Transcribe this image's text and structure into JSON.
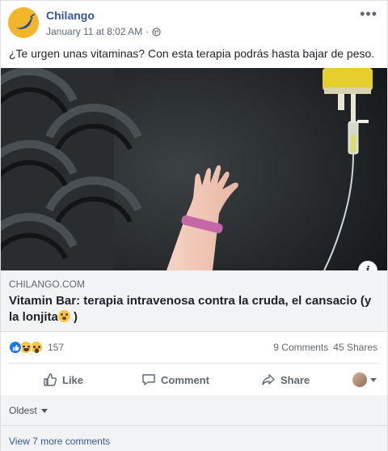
{
  "post": {
    "page_name": "Chilango",
    "timestamp": "January 11 at 8:02 AM",
    "separator": "·",
    "privacy_icon": "globe-icon",
    "more_icon": "more-options-icon",
    "text": "¿Te urgen unas vitaminas? Con esta terapia podrás hasta bajar de peso."
  },
  "link_preview": {
    "domain": "CHILANGO.COM",
    "title_part1": "Vitamin Bar: terapia intravenosa contra la cruda, el cansacio (y la lonjita",
    "title_part2": " )",
    "info_label": "i"
  },
  "reactions": {
    "types": [
      "like",
      "haha",
      "wow"
    ],
    "count": "157",
    "comments": "9 Comments",
    "shares": "45 Shares"
  },
  "actions": {
    "like": "Like",
    "comment": "Comment",
    "share": "Share"
  },
  "comments": {
    "sort_label": "Oldest",
    "view_more": "View 7 more comments"
  },
  "colors": {
    "brand_link": "#365899",
    "muted_text": "#606770",
    "like_blue": "#1877f2",
    "avatar_yellow": "#f3b62b"
  }
}
